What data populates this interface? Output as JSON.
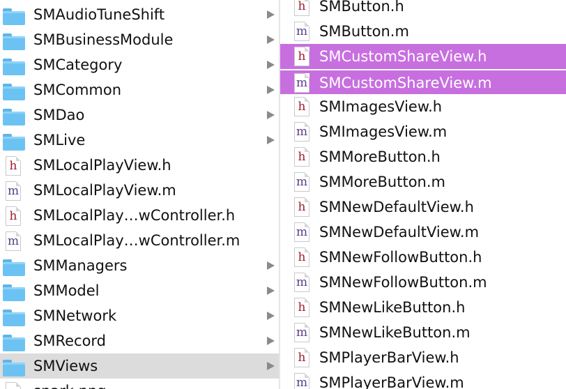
{
  "left_column": {
    "items": [
      {
        "name": "SMAudioTuneShift",
        "kind": "folder",
        "arrow": true
      },
      {
        "name": "SMBusinessModule",
        "kind": "folder",
        "arrow": true
      },
      {
        "name": "SMCategory",
        "kind": "folder",
        "arrow": true
      },
      {
        "name": "SMCommon",
        "kind": "folder",
        "arrow": true
      },
      {
        "name": "SMDao",
        "kind": "folder",
        "arrow": true
      },
      {
        "name": "SMLive",
        "kind": "folder",
        "arrow": true
      },
      {
        "name": "SMLocalPlayView.h",
        "kind": "h",
        "arrow": false
      },
      {
        "name": "SMLocalPlayView.m",
        "kind": "m",
        "arrow": false
      },
      {
        "name": "SMLocalPlay…wController.h",
        "kind": "h",
        "arrow": false
      },
      {
        "name": "SMLocalPlay…wController.m",
        "kind": "m",
        "arrow": false
      },
      {
        "name": "SMManagers",
        "kind": "folder",
        "arrow": true
      },
      {
        "name": "SMModel",
        "kind": "folder",
        "arrow": true
      },
      {
        "name": "SMNetwork",
        "kind": "folder",
        "arrow": true
      },
      {
        "name": "SMRecord",
        "kind": "folder",
        "arrow": true
      },
      {
        "name": "SMViews",
        "kind": "folder",
        "arrow": true,
        "selected": true
      },
      {
        "name": "spark.png",
        "kind": "file",
        "arrow": false
      }
    ]
  },
  "right_column": {
    "items": [
      {
        "name": "SMButton.h",
        "kind": "h"
      },
      {
        "name": "SMButton.m",
        "kind": "m"
      },
      {
        "name": "SMCustomShareView.h",
        "kind": "h",
        "selected": true
      },
      {
        "name": "SMCustomShareView.m",
        "kind": "m",
        "selected": true
      },
      {
        "name": "SMImagesView.h",
        "kind": "h"
      },
      {
        "name": "SMImagesView.m",
        "kind": "m"
      },
      {
        "name": "SMMoreButton.h",
        "kind": "h"
      },
      {
        "name": "SMMoreButton.m",
        "kind": "m"
      },
      {
        "name": "SMNewDefaultView.h",
        "kind": "h"
      },
      {
        "name": "SMNewDefaultView.m",
        "kind": "m"
      },
      {
        "name": "SMNewFollowButton.h",
        "kind": "h"
      },
      {
        "name": "SMNewFollowButton.m",
        "kind": "m"
      },
      {
        "name": "SMNewLikeButton.h",
        "kind": "h"
      },
      {
        "name": "SMNewLikeButton.m",
        "kind": "m"
      },
      {
        "name": "SMPlayerBarView.h",
        "kind": "h"
      },
      {
        "name": "SMPlayerBarView.m",
        "kind": "m"
      }
    ]
  },
  "colors": {
    "selection_highlight": "#c86fe0",
    "folder_selected": "#dcdcdc",
    "folder_blue": "#6cc3f3",
    "header_letter": "#a01c2e",
    "impl_letter": "#5a3d8a"
  }
}
